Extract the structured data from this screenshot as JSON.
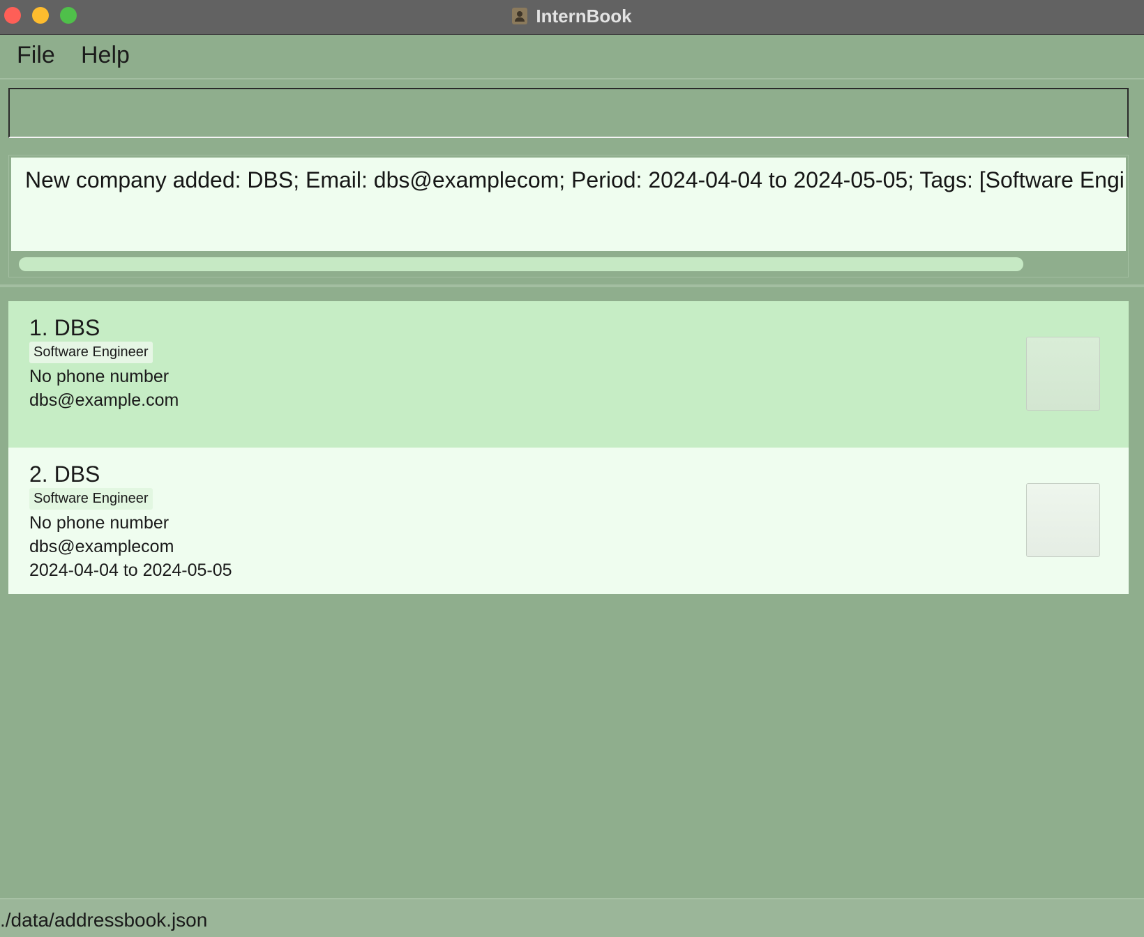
{
  "window": {
    "title": "InternBook"
  },
  "menu": {
    "file": "File",
    "help": "Help"
  },
  "command": {
    "value": "",
    "placeholder": ""
  },
  "result": {
    "text": "New company added: DBS; Email: dbs@examplecom; Period: 2024-04-04 to 2024-05-05; Tags: [Software Engineer]"
  },
  "companies": [
    {
      "title": "1.  DBS",
      "tag": "Software Engineer",
      "phone": "No phone number",
      "email": "dbs@example.com",
      "period": ""
    },
    {
      "title": "2.  DBS",
      "tag": "Software Engineer",
      "phone": "No phone number",
      "email": "dbs@examplecom",
      "period": "2024-04-04 to 2024-05-05"
    }
  ],
  "status": {
    "path": "./data/addressbook.json"
  },
  "colors": {
    "background": "#8fae8d",
    "selected_card": "#c6edc5",
    "card": "#effdef",
    "titlebar": "#626262"
  },
  "icons": {
    "app": "contact-book-icon"
  }
}
